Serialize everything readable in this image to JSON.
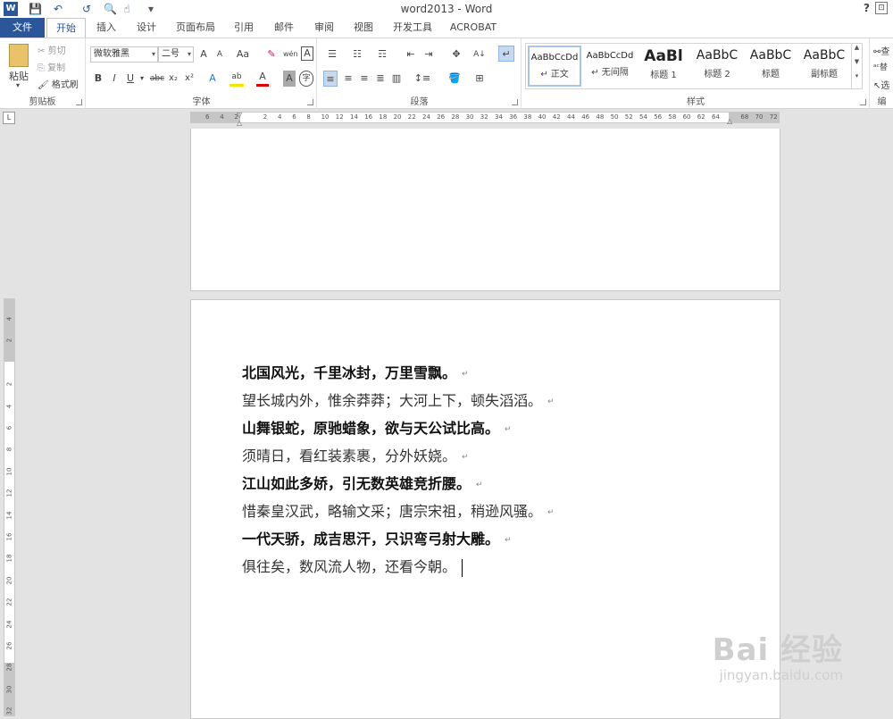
{
  "window": {
    "title": "word2013 - Word",
    "help": "?",
    "ribbon_options": "⊡"
  },
  "quick_access": {
    "word_logo": "W",
    "save": "💾",
    "undo": "↶",
    "redo": "↺",
    "preview": "🔍",
    "touch": "☝",
    "customize": "▾"
  },
  "tabs": [
    {
      "label": "文件"
    },
    {
      "label": "开始"
    },
    {
      "label": "插入"
    },
    {
      "label": "设计"
    },
    {
      "label": "页面布局"
    },
    {
      "label": "引用"
    },
    {
      "label": "邮件"
    },
    {
      "label": "审阅"
    },
    {
      "label": "视图"
    },
    {
      "label": "开发工具"
    },
    {
      "label": "ACROBAT"
    }
  ],
  "clipboard": {
    "paste": "粘贴",
    "cut": "剪切",
    "copy": "复制",
    "format_painter": "格式刷",
    "group_label": "剪贴板"
  },
  "font": {
    "family": "微软雅黑",
    "size": "二号",
    "grow": "A",
    "shrink": "A",
    "change_case": "Aa",
    "clear_format": "✎",
    "phonetic": "wén",
    "border_char": "A",
    "bold": "B",
    "italic": "I",
    "underline": "U",
    "strike": "abc",
    "subscript": "x₂",
    "superscript": "x²",
    "text_effect": "A",
    "highlight": "ab",
    "font_color": "A",
    "shading": "A",
    "enclose": "字",
    "group_label": "字体"
  },
  "paragraph": {
    "group_label": "段落"
  },
  "styles": {
    "group_label": "样式",
    "items": [
      {
        "sample": "AaBbCcDd",
        "name": "↵ 正文"
      },
      {
        "sample": "AaBbCcDd",
        "name": "↵ 无间隔"
      },
      {
        "sample": "AaBl",
        "name": "标题 1"
      },
      {
        "sample": "AaBbC",
        "name": "标题 2"
      },
      {
        "sample": "AaBbC",
        "name": "标题"
      },
      {
        "sample": "AaBbC",
        "name": "副标题"
      }
    ]
  },
  "editing": {
    "find": "查",
    "replace": "替",
    "select": "选",
    "group_label": "编"
  },
  "ruler": {
    "tab_selector": "L",
    "h_ticks": [
      "6",
      "4",
      "2",
      "",
      "2",
      "4",
      "6",
      "8",
      "10",
      "12",
      "14",
      "16",
      "18",
      "20",
      "22",
      "24",
      "26",
      "28",
      "30",
      "32",
      "34",
      "36",
      "38",
      "40",
      "42",
      "44",
      "46",
      "48",
      "50",
      "52",
      "54",
      "56",
      "58",
      "60",
      "62",
      "64",
      "",
      "68",
      "70",
      "72"
    ],
    "v_ticks": [
      "4",
      "2",
      "",
      "2",
      "4",
      "6",
      "8",
      "10",
      "12",
      "14",
      "16",
      "18",
      "20",
      "22",
      "24",
      "26",
      "28",
      "30",
      "32"
    ]
  },
  "document": {
    "lines": [
      {
        "text": "北国风光，千里冰封，万里雪飘。",
        "bold": true,
        "mark": "↵"
      },
      {
        "text": "望长城内外，惟余莽莽；大河上下，顿失滔滔。",
        "bold": false,
        "mark": "↵"
      },
      {
        "text": "山舞银蛇，原驰蜡象，欲与天公试比高。",
        "bold": true,
        "mark": "↵"
      },
      {
        "text": "须晴日，看红装素裹，分外妖娆。",
        "bold": false,
        "mark": "↵"
      },
      {
        "text": "江山如此多娇，引无数英雄竞折腰。",
        "bold": true,
        "mark": "↵"
      },
      {
        "text": "惜秦皇汉武，略输文采；唐宗宋祖，稍逊风骚。",
        "bold": false,
        "mark": "↵"
      },
      {
        "text": "一代天骄，成吉思汗，只识弯弓射大雕。",
        "bold": true,
        "mark": "↵"
      },
      {
        "text": "俱往矣，数风流人物，还看今朝。",
        "bold": false,
        "mark": ""
      }
    ]
  },
  "watermark": {
    "line1": "Bai 经验",
    "line2": "jingyan.baidu.com"
  }
}
